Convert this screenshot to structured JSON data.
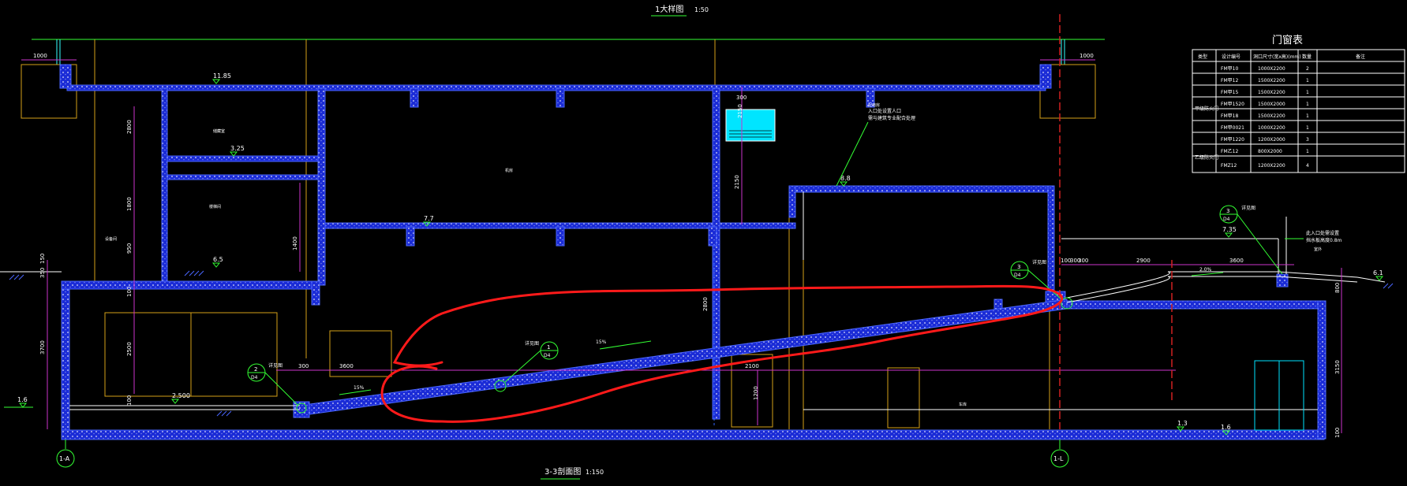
{
  "top_title": {
    "label": "1大样图",
    "scale": "1:50"
  },
  "bottom_title": {
    "label": "3-3剖面图",
    "scale": "1:150"
  },
  "grid_axes": [
    "1-A",
    "1-L"
  ],
  "elevations": [
    "11.85",
    "3.25",
    "7.7",
    "6.5",
    "8.8",
    "2.500",
    "1.6",
    "7.35",
    "6.1",
    "1.3",
    "1.6"
  ],
  "dimensions": {
    "left_vertical": [
      "2800",
      "1800",
      "950",
      "100",
      "2500",
      "100",
      "3700",
      "350",
      "150"
    ],
    "top_small": [
      "1000",
      "1000",
      "300"
    ],
    "mid": [
      "300",
      "3600",
      "2800",
      "1400",
      "1200",
      "2150",
      "2900",
      "3600",
      "800",
      "300",
      "100",
      "300",
      "2100",
      "2150",
      "3150",
      "100"
    ]
  },
  "slopes": [
    "15%",
    "15%",
    "2.0%"
  ],
  "detail_callouts": [
    {
      "num": "2",
      "sheet": "D4",
      "label": "详见图"
    },
    {
      "num": "1",
      "sheet": "D4",
      "label": "详见图"
    },
    {
      "num": "3",
      "sheet": "D4",
      "label": "详见图"
    },
    {
      "num": "3",
      "sheet": "D4",
      "label": "详见图"
    }
  ],
  "leader_note": [
    "入口处设置人口",
    "需与建筑专业配合处理"
  ],
  "right_note": [
    "此入口处需设置",
    "挡水板高度0.8m"
  ],
  "room_labels": [
    "设备间",
    "楼梯间",
    "机房",
    "车库",
    "储藏室",
    "配电房",
    "室外"
  ],
  "door_table": {
    "title": "门窗表",
    "headers": [
      "类型",
      "设计编号",
      "洞口尺寸(宽x高)(mm)",
      "数量",
      "备注"
    ],
    "groups": [
      {
        "type": "甲级防火门",
        "rows": [
          [
            "FM甲10",
            "1000X2200",
            "2",
            ""
          ],
          [
            "FM甲12",
            "1500X2200",
            "1",
            ""
          ],
          [
            "FM甲15",
            "1500X2200",
            "1",
            ""
          ],
          [
            "FM甲1520",
            "1500X2000",
            "1",
            ""
          ],
          [
            "FM甲18",
            "1500X2200",
            "1",
            ""
          ],
          [
            "FM甲0021",
            "1000X2200",
            "1",
            ""
          ],
          [
            "FM甲1220",
            "1200X2000",
            "3",
            ""
          ]
        ]
      },
      {
        "type": "乙级防火门",
        "rows": [
          [
            "FM乙12",
            "800X2000",
            "1",
            ""
          ],
          [
            "FMZ12",
            "1200X2200",
            "4",
            ""
          ]
        ]
      }
    ]
  },
  "colors": {
    "background": "#000000",
    "wall_hatch": "#2a3cff",
    "dim_lines": "#cc33cc",
    "annotation": "#33ff33",
    "outline": "#ffffff",
    "yellow_lines": "#d4a017",
    "markup": "#ff1a1a",
    "glazing": "#00ffff"
  }
}
